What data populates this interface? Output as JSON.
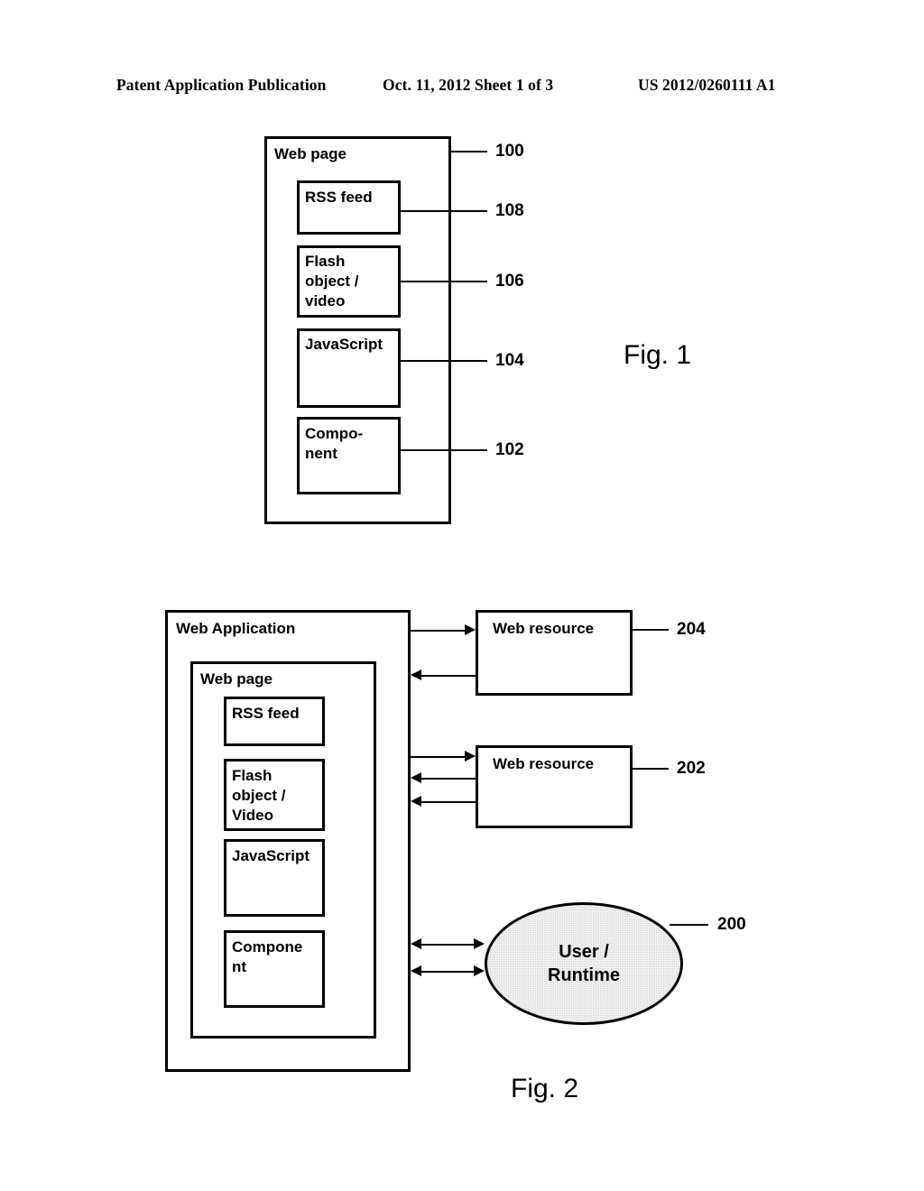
{
  "header": {
    "left": "Patent Application Publication",
    "middle": "Oct. 11, 2012  Sheet 1 of 3",
    "right": "US 2012/0260111 A1"
  },
  "figure1": {
    "caption": "Fig. 1",
    "container": {
      "label": "Web page",
      "ref": "100"
    },
    "blocks": [
      {
        "label": "RSS feed",
        "ref": "108"
      },
      {
        "label": "Flash\nobject /\nvideo",
        "ref": "106"
      },
      {
        "label": "JavaScript",
        "ref": "104"
      },
      {
        "label": "Compo-\nnent",
        "ref": "102"
      }
    ]
  },
  "figure2": {
    "caption": "Fig. 2",
    "application": {
      "label": "Web Application"
    },
    "webpage": {
      "label": "Web page"
    },
    "blocks": [
      {
        "label": "RSS feed"
      },
      {
        "label": "Flash\nobject /\nVideo"
      },
      {
        "label": "JavaScript"
      },
      {
        "label": "Compone\nnt"
      }
    ],
    "resources": [
      {
        "label": "Web resource",
        "ref": "204"
      },
      {
        "label": "Web resource",
        "ref": "202"
      }
    ],
    "actor": {
      "label": "User /\nRuntime",
      "ref": "200",
      "fill": "#d8d8d8"
    }
  }
}
